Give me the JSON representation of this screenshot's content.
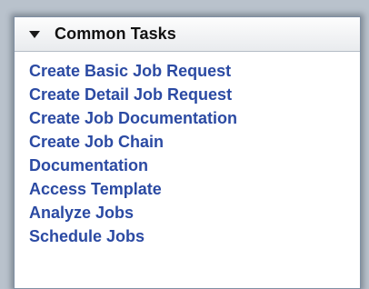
{
  "panel": {
    "title": "Common Tasks",
    "collapse_icon": "triangle-down-icon"
  },
  "tasks": [
    "Create Basic Job Request",
    "Create Detail Job Request",
    "Create Job Documentation",
    "Create Job Chain",
    "Documentation",
    "Access Template",
    "Analyze Jobs",
    "Schedule Jobs"
  ],
  "colors": {
    "link": "#2b4aa3",
    "header_text": "#111111",
    "background": "#b9c2cc"
  }
}
